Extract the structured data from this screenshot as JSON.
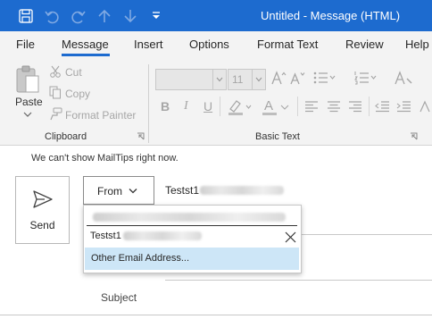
{
  "window": {
    "title": "Untitled  -  Message (HTML)"
  },
  "tabs": [
    {
      "label": "File"
    },
    {
      "label": "Message"
    },
    {
      "label": "Insert"
    },
    {
      "label": "Options"
    },
    {
      "label": "Format Text"
    },
    {
      "label": "Review"
    },
    {
      "label": "Help"
    }
  ],
  "clipboard": {
    "paste_label": "Paste",
    "cut_label": "Cut",
    "copy_label": "Copy",
    "format_painter_label": "Format Painter",
    "group_label": "Clipboard"
  },
  "basic_text": {
    "font_size": "11",
    "bold": "B",
    "italic": "I",
    "underline": "U",
    "font_color_letter": "A",
    "group_label": "Basic Text"
  },
  "compose": {
    "mailtips": "We can't show MailTips right now.",
    "send_label": "Send",
    "from_label": "From",
    "from_value_prefix": "Testst1",
    "subject_label": "Subject"
  },
  "from_dropdown": {
    "selected_prefix": "Testst1",
    "other_label": "Other Email Address..."
  },
  "colors": {
    "accent": "#1d6bcf",
    "ribbon_bg": "#f3f3f3",
    "highlight": "#cde6f7"
  }
}
